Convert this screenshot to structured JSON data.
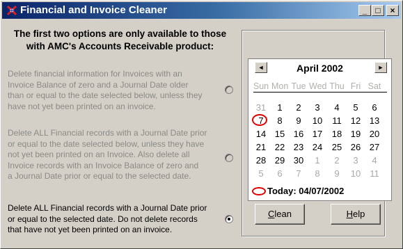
{
  "window": {
    "title": "Financial and Invoice Cleaner",
    "controls": {
      "minimize": "_",
      "maximize": "□",
      "close": "×"
    }
  },
  "heading": {
    "line1": "The first two options are only available to those",
    "line2": "with AMC's Accounts Receivable product:"
  },
  "options": [
    {
      "lines": [
        "Delete financial information for Invoices with an",
        "Invoice Balance of zero and a Journal Date older",
        "than or equal to the date selected below, unless they",
        "have not yet been printed on an invoice."
      ],
      "enabled": false,
      "selected": false
    },
    {
      "lines": [
        "Delete ALL Financial records with a Journal Date prior",
        "or equal to the date selected below, unless they have",
        "not yet been printed on an Invoice. Also delete all",
        "Invoice records with an Invoice Balance of zero and",
        "a Journal Date prior or equal to the selected date."
      ],
      "enabled": false,
      "selected": false
    },
    {
      "lines": [
        "Delete ALL Financial records with a Journal Date prior",
        "or equal to the selected date. Do not delete records",
        "that have not yet been printed on an invoice."
      ],
      "enabled": true,
      "selected": true
    }
  ],
  "calendar": {
    "month_label": "April 2002",
    "prev_icon": "◄",
    "next_icon": "►",
    "weekdays": [
      "Sun",
      "Mon",
      "Tue",
      "Wed",
      "Thu",
      "Fri",
      "Sat"
    ],
    "weeks": [
      [
        "31",
        "1",
        "2",
        "3",
        "4",
        "5",
        "6"
      ],
      [
        "7",
        "8",
        "9",
        "10",
        "11",
        "12",
        "13"
      ],
      [
        "14",
        "15",
        "16",
        "17",
        "18",
        "19",
        "20"
      ],
      [
        "21",
        "22",
        "23",
        "24",
        "25",
        "26",
        "27"
      ],
      [
        "28",
        "29",
        "30",
        "1",
        "2",
        "3",
        "4"
      ],
      [
        "5",
        "6",
        "7",
        "8",
        "9",
        "10",
        "11"
      ]
    ],
    "selected_day": "7",
    "today_label": "Today: 04/07/2002",
    "accent_color": "#e00000"
  },
  "buttons": {
    "clean": {
      "hotkey": "C",
      "rest": "lean"
    },
    "help": {
      "hotkey": "H",
      "rest": "elp"
    }
  }
}
